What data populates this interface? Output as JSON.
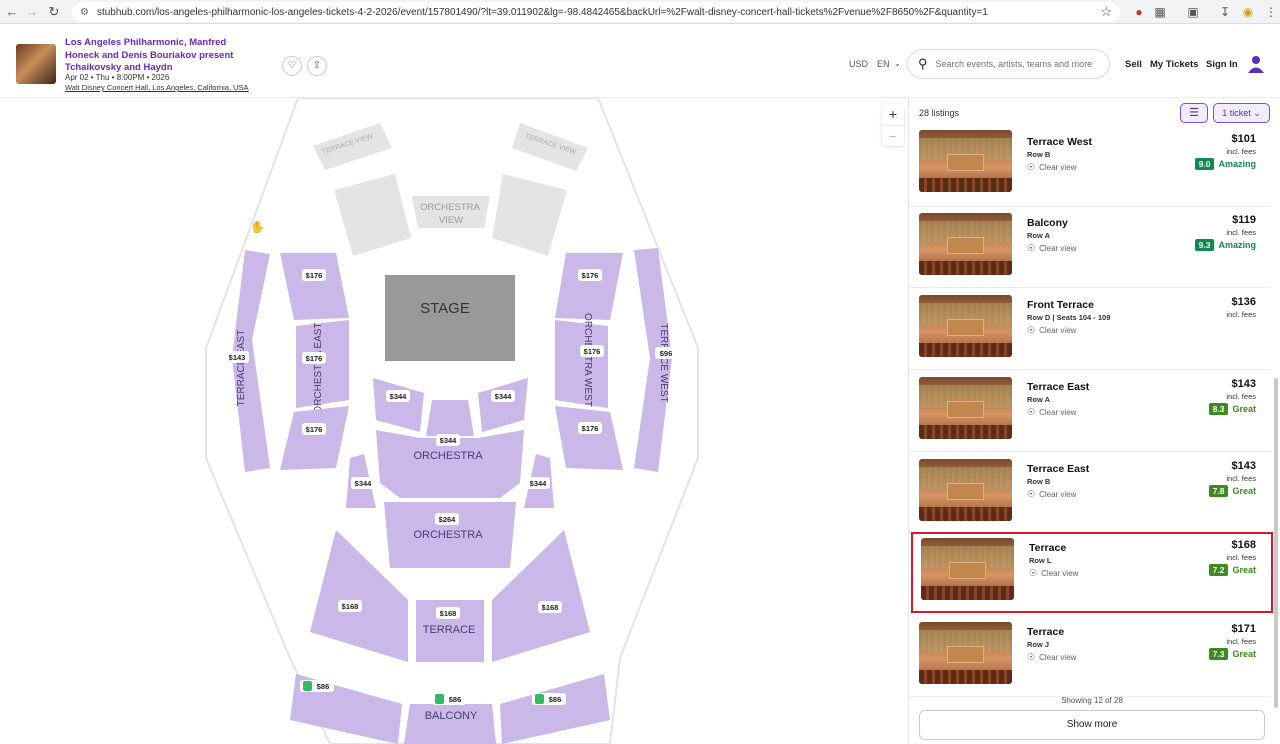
{
  "browser": {
    "url": "stubhub.com/los-angeles-philharmonic-los-angeles-tickets-4-2-2026/event/157801490/?lt=39.011902&lg=-98.4842465&backUrl=%2Fwalt-disney-concert-hall-tickets%2Fvenue%2F8650%2F&quantity=1"
  },
  "event": {
    "title": "Los Angeles Philharmonic, Manfred Honeck and Denis Bouriakov present Tchaikovsky and Haydn",
    "date": "Apr 02 • Thu • 8:00PM • 2026",
    "venue": "Walt Disney Concert Hall, Los Angeles, California, USA"
  },
  "header": {
    "currency": "USD",
    "language": "EN",
    "search_placeholder": "Search events, artists, teams and more",
    "sell": "Sell",
    "my_tickets": "My Tickets",
    "sign_in": "Sign In"
  },
  "map": {
    "stage": "STAGE",
    "orchestra_view": "ORCHESTRA VIEW",
    "terrace_view": "TERRACE VIEW",
    "terrace_east": "TERRACE EAST",
    "orchestra_east": "ORCHESTRA EAST",
    "orchestra_west": "ORCHESTRA WEST",
    "terrace_west": "TERRACE WEST",
    "orchestra": "ORCHESTRA",
    "terrace": "TERRACE",
    "balcony": "BALCONY",
    "prices": {
      "oe_top": "$176",
      "oe_mid": "$176",
      "oe_bot": "$176",
      "ow_top": "$176",
      "ow_mid": "$176",
      "ow_bot": "$176",
      "te": "$143",
      "tw": "$96",
      "orch_l": "$344",
      "orch_r": "$344",
      "orch_c": "$344",
      "orch_ll": "$344",
      "orch_rr": "$344",
      "orch_low": "$264",
      "ter_l": "$168",
      "ter_c": "$168",
      "ter_r": "$168",
      "bal_l": "$86",
      "bal_c": "$86",
      "bal_r": "$86"
    }
  },
  "listings_panel": {
    "count": "28 listings",
    "quantity": "1 ticket",
    "showing": "Showing 12 of 28",
    "show_more": "Show more",
    "clear_view": "Clear view",
    "incl_fees": "incl. fees",
    "items": [
      {
        "name": "Terrace West",
        "row": "Row B",
        "price": "$101",
        "score": "9.0",
        "rating": "Amazing",
        "color": "#0f8a4d"
      },
      {
        "name": "Balcony",
        "row": "Row A",
        "price": "$119",
        "score": "9.3",
        "rating": "Amazing",
        "color": "#0f8a4d"
      },
      {
        "name": "Front Terrace",
        "row": "Row D | Seats 104 - 109",
        "price": "$136",
        "score": "",
        "rating": "",
        "color": "#0f8a4d"
      },
      {
        "name": "Terrace East",
        "row": "Row A",
        "price": "$143",
        "score": "8.3",
        "rating": "Great",
        "color": "#3d8b1f"
      },
      {
        "name": "Terrace East",
        "row": "Row B",
        "price": "$143",
        "score": "7.8",
        "rating": "Great",
        "color": "#3d8b1f"
      },
      {
        "name": "Terrace",
        "row": "Row L",
        "price": "$168",
        "score": "7.2",
        "rating": "Great",
        "color": "#3d8b1f"
      },
      {
        "name": "Terrace",
        "row": "Row J",
        "price": "$171",
        "score": "7.3",
        "rating": "Great",
        "color": "#3d8b1f"
      }
    ]
  },
  "colors": {
    "accent": "#6a29c9",
    "section_fill": "#c9b8e8",
    "selected_border": "#d71a2a"
  }
}
